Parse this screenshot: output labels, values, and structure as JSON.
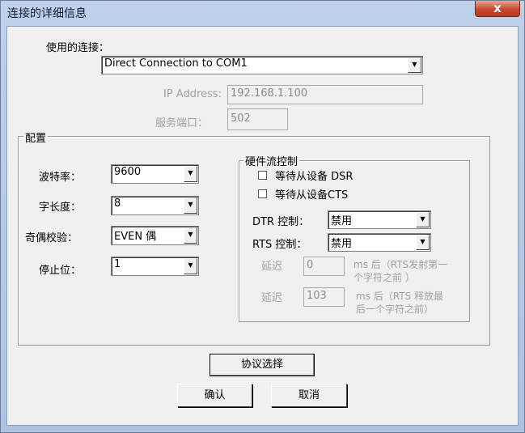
{
  "window": {
    "title": "连接的详细信息",
    "close_glyph": "x"
  },
  "connection": {
    "label": "使用的连接：",
    "value": "Direct Connection to COM1"
  },
  "ip": {
    "label": "IP Address:",
    "value": "192.168.1.100"
  },
  "port": {
    "label": "服务端口：",
    "value": "502"
  },
  "config": {
    "title": "配置",
    "baud": {
      "label": "波特率：",
      "value": "9600"
    },
    "data_bits": {
      "label": "字长度：",
      "value": "8"
    },
    "parity": {
      "label": "奇偶校验：",
      "value": "EVEN 偶"
    },
    "stop_bits": {
      "label": "停止位：",
      "value": "1"
    }
  },
  "flow": {
    "title": "硬件流控制",
    "wait_dsr": "等待从设备 DSR",
    "wait_cts": "等待从设备CTS",
    "dtr": {
      "label": "DTR 控制：",
      "value": "禁用"
    },
    "rts": {
      "label": "RTS 控制：",
      "value": "禁用"
    },
    "delay1": {
      "label": "延迟",
      "value": "0",
      "unit_line1": "ms 后（RTS发射第一",
      "unit_line2": "个字符之前 ）"
    },
    "delay2": {
      "label": "延迟",
      "value": "103",
      "unit_line1": "ms 后（RTS 释放最",
      "unit_line2": "后一个字符之前）"
    }
  },
  "buttons": {
    "protocol": "协议选择",
    "ok": "确认",
    "cancel": "取消"
  },
  "icons": {
    "dropdown": "dropdown-arrow-icon",
    "close": "close-icon"
  }
}
